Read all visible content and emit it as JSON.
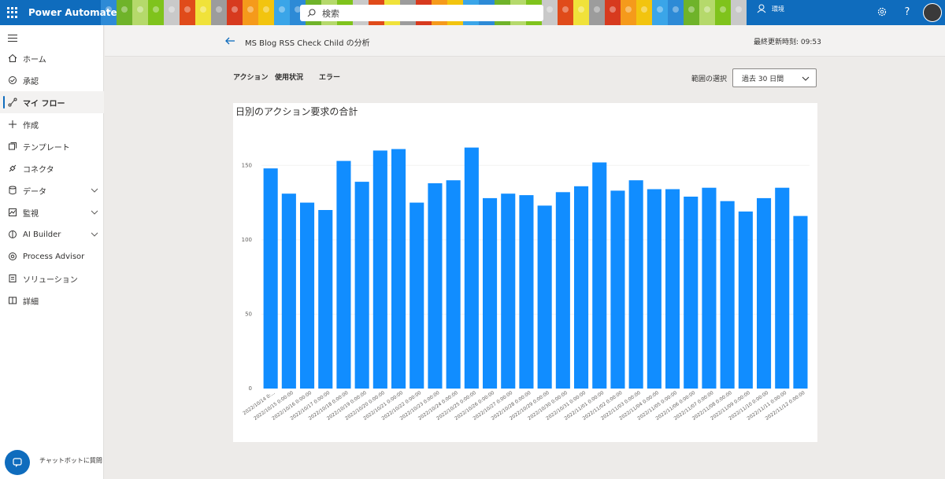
{
  "app": {
    "name": "Power Automate"
  },
  "topbar": {
    "search_placeholder": "検索",
    "environment_label": "環境",
    "icons": [
      "waffle-icon",
      "search-icon",
      "environment-icon",
      "settings-icon",
      "help-icon",
      "avatar"
    ]
  },
  "sidebar": {
    "items": [
      {
        "label": "ホーム",
        "icon": "home-icon"
      },
      {
        "label": "承認",
        "icon": "approvals-icon"
      },
      {
        "label": "マイ フロー",
        "icon": "flow-icon",
        "active": true
      },
      {
        "label": "作成",
        "icon": "plus-icon"
      },
      {
        "label": "テンプレート",
        "icon": "template-icon"
      },
      {
        "label": "コネクタ",
        "icon": "connector-icon"
      },
      {
        "label": "データ",
        "icon": "database-icon",
        "expandable": true
      },
      {
        "label": "監視",
        "icon": "monitor-icon",
        "expandable": true
      },
      {
        "label": "AI Builder",
        "icon": "ai-builder-icon",
        "expandable": true
      },
      {
        "label": "Process Advisor",
        "icon": "process-advisor-icon"
      },
      {
        "label": "ソリューション",
        "icon": "solution-icon"
      },
      {
        "label": "詳細",
        "icon": "book-icon"
      }
    ],
    "chatbot_label": "チャットボットに質問"
  },
  "header": {
    "flow_title": "MS Blog RSS Check Child の分析",
    "last_updated": "最終更新時刻: 09:53"
  },
  "tabs": [
    {
      "label": "アクション"
    },
    {
      "label": "使用状況"
    },
    {
      "label": "エラー"
    }
  ],
  "range": {
    "label": "範囲の選択",
    "selected": "過去 30 日間"
  },
  "colors": {
    "brand": "#0f6cbd",
    "bar": "#118dff"
  },
  "chart_data": {
    "type": "bar",
    "title": "日別のアクション要求の合計",
    "categories": [
      "2022/10/14 0:...",
      "2022/10/15 0:00:00",
      "2022/10/16 0:00:00",
      "2022/10/17 0:00:00",
      "2022/10/18 0:00:00",
      "2022/10/19 0:00:00",
      "2022/10/20 0:00:00",
      "2022/10/21 0:00:00",
      "2022/10/22 0:00:00",
      "2022/10/23 0:00:00",
      "2022/10/24 0:00:00",
      "2022/10/25 0:00:00",
      "2022/10/26 0:00:00",
      "2022/10/27 0:00:00",
      "2022/10/28 0:00:00",
      "2022/10/29 0:00:00",
      "2022/10/30 0:00:00",
      "2022/10/31 0:00:00",
      "2022/11/01 0:00:00",
      "2022/11/02 0:00:00",
      "2022/11/03 0:00:00",
      "2022/11/04 0:00:00",
      "2022/11/05 0:00:00",
      "2022/11/06 0:00:00",
      "2022/11/07 0:00:00",
      "2022/11/08 0:00:00",
      "2022/11/09 0:00:00",
      "2022/11/10 0:00:00",
      "2022/11/11 0:00:00",
      "2022/11/12 0:00:00"
    ],
    "values": [
      148,
      131,
      125,
      120,
      153,
      139,
      160,
      161,
      125,
      138,
      140,
      162,
      128,
      131,
      130,
      123,
      132,
      136,
      152,
      133,
      140,
      134,
      134,
      129,
      135,
      126,
      119,
      128,
      135,
      116
    ],
    "yticks": [
      0,
      50,
      100,
      150
    ],
    "ylim": [
      0,
      175
    ],
    "grid": true,
    "legend": false
  }
}
